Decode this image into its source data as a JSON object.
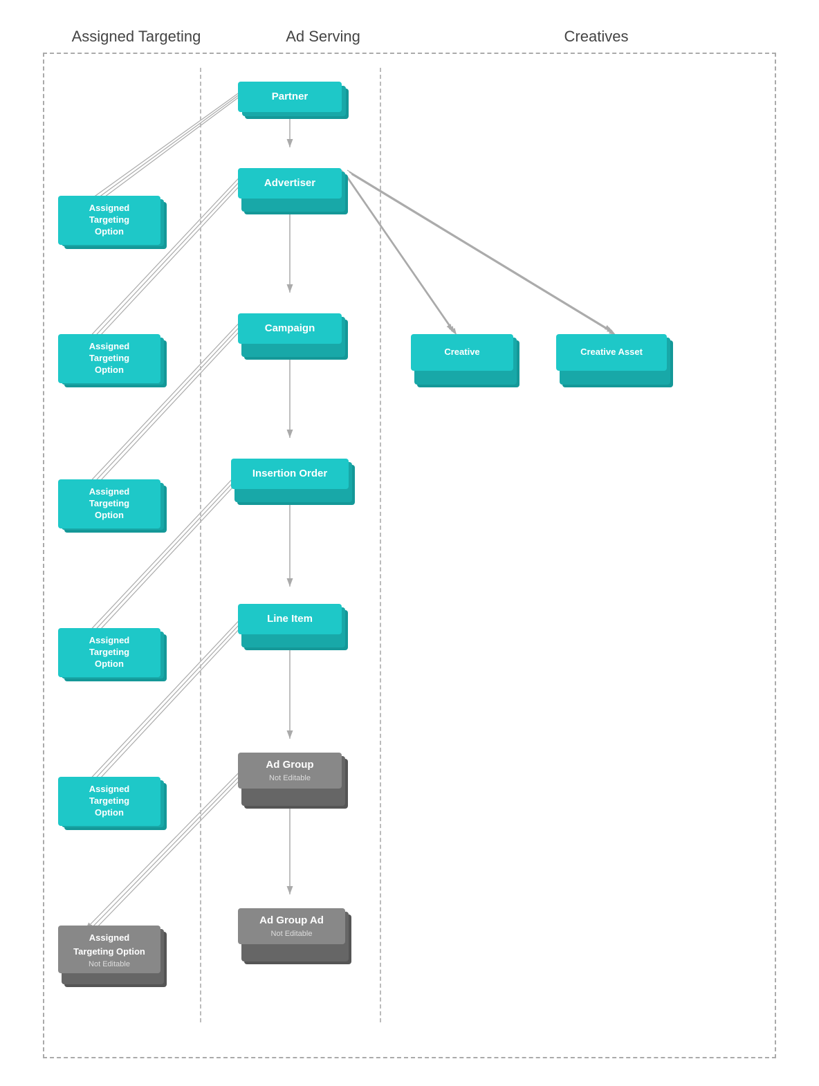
{
  "headers": {
    "assigned_targeting": "Assigned Targeting",
    "ad_serving": "Ad Serving",
    "creatives": "Creatives"
  },
  "nodes": {
    "partner": "Partner",
    "advertiser": "Advertiser",
    "campaign": "Campaign",
    "insertion_order": "Insertion Order",
    "line_item": "Line Item",
    "ad_group": "Ad Group",
    "ad_group_not_editable": "Not Editable",
    "ad_group_ad": "Ad Group Ad",
    "ad_group_ad_not_editable": "Not Editable",
    "creative": "Creative",
    "creative_asset": "Creative Asset",
    "assigned_targeting_option": "Assigned Targeting Option",
    "not_editable": "Not Editable"
  },
  "colors": {
    "teal": "#1ec8c8",
    "teal_dark": "#18a8a8",
    "teal_darker": "#149898",
    "gray": "#888888",
    "gray_dark": "#666666",
    "gray_darker": "#555555",
    "arrow": "#aaaaaa",
    "dashed_border": "#aaaaaa",
    "column_divider": "#bbbbbb"
  }
}
